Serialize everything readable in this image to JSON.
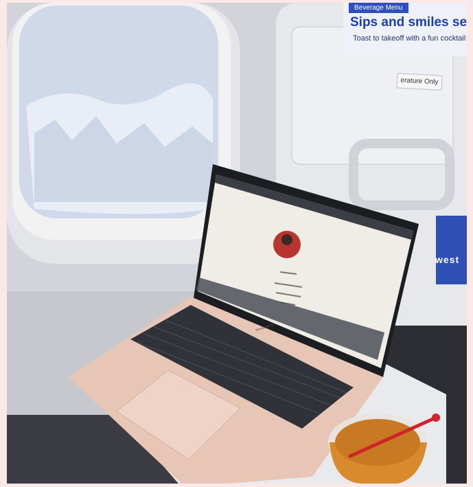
{
  "menu": {
    "header": "Beverage Menu",
    "title": "Sips and smiles servec",
    "subtitle": "Toast to takeoff with a fun cocktail or enjo"
  },
  "tray_label": "erature Only",
  "seat_pocket_text": "west",
  "laptop_brand": "MacBook Air",
  "colors": {
    "laptop": "#e8c6b6",
    "keys": "#2f3339",
    "sky": "#cfd9ea",
    "brand_blue": "#2f4fbf",
    "drink": "#d98a2c"
  }
}
